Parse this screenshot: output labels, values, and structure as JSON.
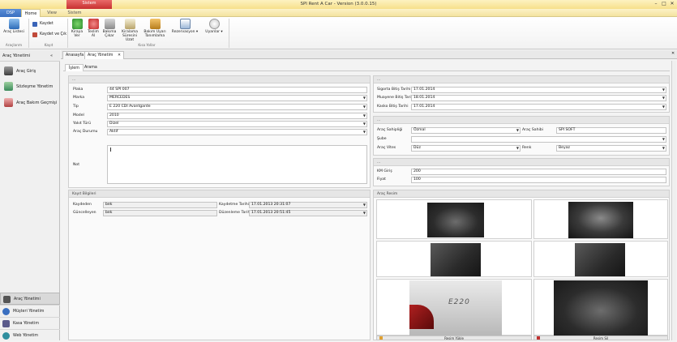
{
  "app": {
    "title": "SPI Rent A Car - Version (3.0.0.15)",
    "context_tab": "Sistem",
    "colors": {
      "accent": "#f7e08a",
      "ctx_tab": "#c83030",
      "file_tab": "#3a6fc0"
    }
  },
  "ribbon": {
    "tabs": [
      "DSP",
      "Home",
      "View",
      "Sistem"
    ],
    "groups": [
      {
        "label": "Araçlarım",
        "items": [
          {
            "label": "Araç Listesi",
            "icon": "car-list-icon"
          }
        ]
      },
      {
        "label": "Kayıt",
        "items": [
          {
            "label": "Kaydet",
            "icon": "save-icon"
          },
          {
            "label": "Kaydet ve Çık",
            "icon": "save-close-icon"
          }
        ]
      },
      {
        "label": "Kısa Yollar",
        "items": [
          {
            "label": "Kiraya Ver",
            "icon": "rent-icon"
          },
          {
            "label": "Teslim Al",
            "icon": "receive-icon"
          },
          {
            "label": "Bakıma Çıkar",
            "icon": "maintenance-icon"
          },
          {
            "label": "Kiralama Süresini Uzat",
            "icon": "extend-icon"
          },
          {
            "label": "Bakım Uyarı Tanımlama",
            "icon": "tools-icon"
          },
          {
            "label": "Rezervasyon",
            "icon": "calendar-icon"
          },
          {
            "label": "Uyarılar",
            "icon": "warning-icon"
          }
        ]
      }
    ]
  },
  "leftpane": {
    "header": "Araç Yönetimi",
    "items": [
      "Araç Giriş",
      "Sözleşme Yönetim",
      "Araç Bakım Geçmişi"
    ],
    "bottom": [
      "Araç Yönetimi",
      "Müşteri Yönetim",
      "Kasa Yönetim",
      "Web Yönetim"
    ]
  },
  "doctabs": [
    "Anasayfa",
    "Araç Yönetim"
  ],
  "subtabs": [
    "İşlem",
    "Arama"
  ],
  "vehicle": {
    "header": "...",
    "fields": [
      {
        "label": "Plaka",
        "value": "44 SPI 007",
        "dropdown": false
      },
      {
        "label": "Marka",
        "value": "MERCEDES",
        "dropdown": true
      },
      {
        "label": "Tip",
        "value": "E 220 CDI Avantgarde",
        "dropdown": true
      },
      {
        "label": "Model",
        "value": "2010",
        "dropdown": true
      },
      {
        "label": "Yakıt Türü",
        "value": "Dizel",
        "dropdown": true
      },
      {
        "label": "Araç Durumu",
        "value": "Aktif",
        "dropdown": true
      }
    ],
    "note_label": "Not",
    "note_value": ""
  },
  "record": {
    "header": "Kayıt Bilgileri",
    "created_by_label": "Kaydeden",
    "created_by": "bek",
    "created_date_label": "Kaydetme Tarihi",
    "created_date": "17.01.2013 20:31:07",
    "updated_by_label": "Güncelleyen",
    "updated_by": "bek",
    "updated_date_label": "Düzenleme Tarihi",
    "updated_date": "17.01.2013 20:51:45"
  },
  "dates": {
    "header": "...",
    "fields": [
      {
        "label": "Sigorta Bitiş Tarihi",
        "value": "17.01.2014"
      },
      {
        "label": "Muayene Bitiş Tarihi",
        "value": "18.01.2014"
      },
      {
        "label": "Kasko Bitiş Tarihi",
        "value": "17.01.2014"
      }
    ]
  },
  "owner": {
    "header": "...",
    "sahipligi_label": "Araç Sahipliği",
    "sahipligi": "Özmal",
    "sahibi_label": "Araç Sahibi",
    "sahibi": "SPI SOFT",
    "sube_label": "Şube",
    "sube": "",
    "vites_label": "Araç Vites",
    "vites": "Düz",
    "renk_label": "Renk",
    "renk": "Beyaz"
  },
  "km": {
    "header": "...",
    "km_label": "KM Giriş",
    "km": "200",
    "fiyat_label": "Fiyat",
    "fiyat": "100"
  },
  "photos": {
    "header": "Araç Resim",
    "upload_label": "Resim Yükle",
    "delete_label": "Resim Sil"
  }
}
